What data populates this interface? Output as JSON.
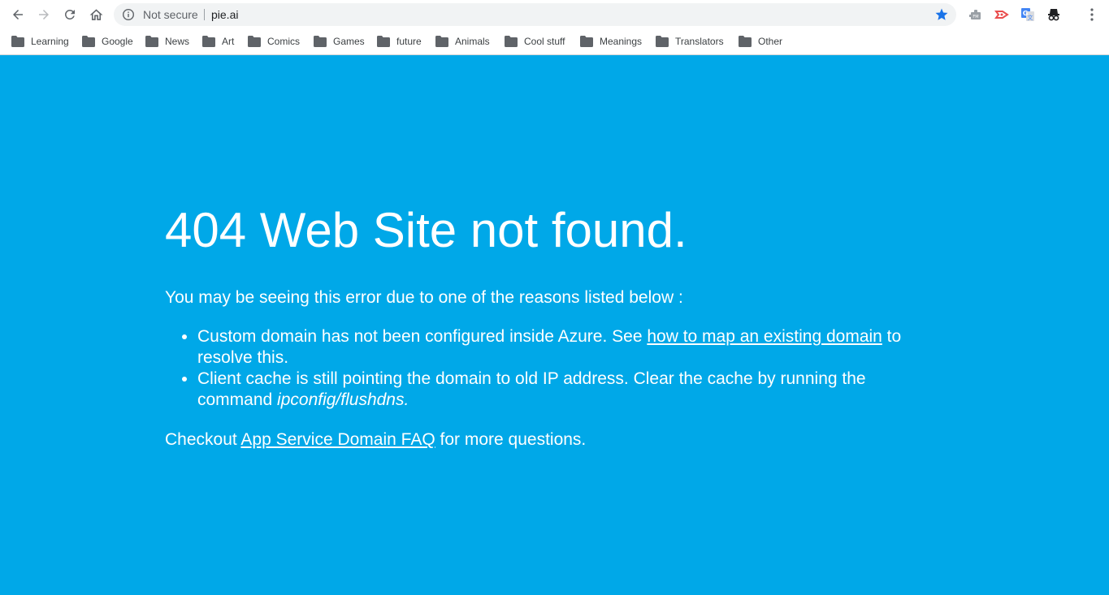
{
  "toolbar": {
    "back": "back-icon",
    "forward": "forward-icon",
    "reload": "reload-icon",
    "home": "home-icon",
    "security_label": "Not secure",
    "url": "pie.ai",
    "extensions": [
      "puzzle-extension-icon",
      "red-arrow-extension-icon",
      "translate-extension-icon",
      "incognito-extension-icon"
    ],
    "menu": "more-menu-icon"
  },
  "bookmarks": [
    {
      "label": "Learning"
    },
    {
      "label": "Google"
    },
    {
      "label": "News"
    },
    {
      "label": "Art"
    },
    {
      "label": "Comics"
    },
    {
      "label": "Games"
    },
    {
      "label": "future"
    },
    {
      "label": "Animals"
    },
    {
      "label": "Cool stuff"
    },
    {
      "label": "Meanings"
    },
    {
      "label": "Translators"
    },
    {
      "label": "Other"
    }
  ],
  "page": {
    "background_color": "#00a8e8",
    "heading": "404 Web Site not found.",
    "intro": "You may be seeing this error due to one of the reasons listed below :",
    "reason1": {
      "before": "Custom domain has not been configured inside Azure. See ",
      "link": "how to map an existing domain",
      "after": " to resolve this."
    },
    "reason2": {
      "before": "Client cache is still pointing the domain to old IP address. Clear the cache by running the command ",
      "command": "ipconfig/flushdns."
    },
    "footer": {
      "before": "Checkout ",
      "link": "App Service Domain FAQ",
      "after": " for more questions."
    }
  }
}
